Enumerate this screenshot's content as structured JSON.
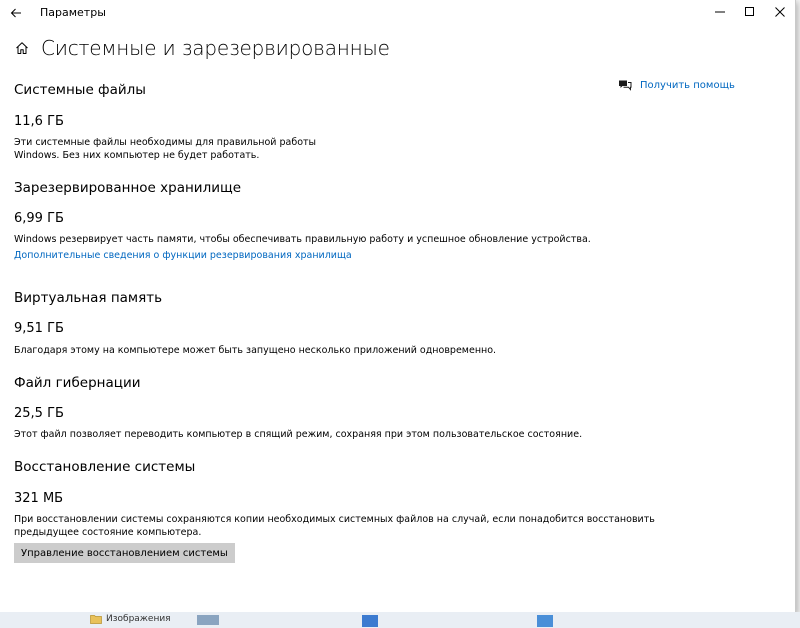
{
  "window": {
    "app_title": "Параметры",
    "icons": {
      "back": "back-arrow-icon",
      "minimize": "minimize-icon",
      "maximize": "maximize-icon",
      "close": "close-icon",
      "home": "home-icon",
      "help": "help-chat-icon"
    }
  },
  "page": {
    "title": "Системные и зарезервированные",
    "help_label": "Получить помощь"
  },
  "sections": [
    {
      "title": "Системные файлы",
      "size": "11,6 ГБ",
      "description_lines": [
        "Эти системные файлы необходимы для правильной работы",
        "Windows. Без них компьютер не будет работать."
      ]
    },
    {
      "title": "Зарезервированное хранилище",
      "size": "6,99 ГБ",
      "description_lines": [
        "Windows резервирует часть памяти, чтобы обеспечивать правильную работу и успешное обновление устройства."
      ],
      "link": "Дополнительные сведения о функции резервирования хранилища"
    },
    {
      "title": "Виртуальная память",
      "size": "9,51 ГБ",
      "description_lines": [
        "Благодаря этому на компьютере может быть запущено несколько приложений одновременно."
      ]
    },
    {
      "title": "Файл гибернации",
      "size": "25,5 ГБ",
      "description_lines": [
        "Этот файл позволяет переводить компьютер в спящий режим, сохраняя при этом пользовательское состояние."
      ]
    },
    {
      "title": "Восстановление системы",
      "size": "321 МБ",
      "description_lines": [
        "При восстановлении системы сохраняются копии необходимых системных файлов на случай, если понадобится восстановить",
        "предыдущее состояние компьютера."
      ],
      "button": "Управление восстановлением системы"
    }
  ],
  "taskbar": {
    "item_label": "Изображения"
  },
  "colors": {
    "link": "#0067c0",
    "button_bg": "#cccccc",
    "window_bg": "#ffffff"
  }
}
